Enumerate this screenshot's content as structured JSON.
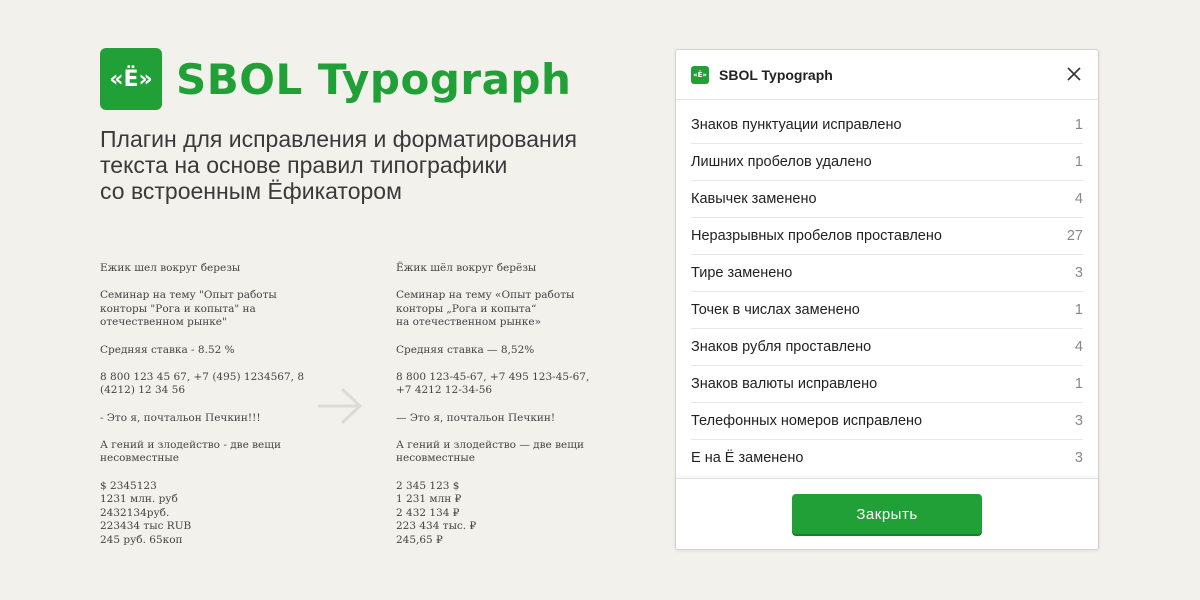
{
  "brand": {
    "logo_text": "«Ё»",
    "title": "SBOL Typograph"
  },
  "tagline": [
    "Плагин для исправления и форматирования",
    "текста на основе правил типографики",
    "со встроенным Ёфикатором"
  ],
  "sample_before": [
    "Ежик шел вокруг березы",
    "Семинар на тему \"Опыт работы\nконторы \"Рога и копыта\" на\nотечественном рынке\"",
    "Средняя ставка - 8.52 %",
    "8 800 123 45 67, +7 (495) 1234567, 8\n(4212) 12 34 56",
    "- Это я, почтальон Печкин!!!",
    "А гений и злодейство - две вещи\nнесовместные",
    "$ 2345123\n1231 млн. руб\n2432134руб.\n223434 тыс RUB\n245 руб. 65коп"
  ],
  "sample_after": [
    "Ёжик шёл вокруг берёзы",
    "Семинар на тему «Опыт работы\nконторы „Рога и копыта“\nна отечественном рынке»",
    "Средняя ставка — 8,52%",
    "8 800 123-45-67, +7 495 123-45-67,\n+7 4212 12-34-56",
    "— Это я, почтальон Печкин!",
    "А гений и злодейство — две вещи\nнесовместные",
    "2 345 123 $\n1 231 млн ₽\n2 432 134 ₽\n223 434 тыс. ₽\n245,65 ₽"
  ],
  "dialog": {
    "logo_text": "«Ё»",
    "title": "SBOL Typograph",
    "stats": [
      {
        "label": "Знаков пунктуации исправлено",
        "value": "1"
      },
      {
        "label": "Лишних пробелов удалено",
        "value": "1"
      },
      {
        "label": "Кавычек заменено",
        "value": "4"
      },
      {
        "label": "Неразрывных пробелов проставлено",
        "value": "27"
      },
      {
        "label": "Тире заменено",
        "value": "3"
      },
      {
        "label": "Точек в числах заменено",
        "value": "1"
      },
      {
        "label": "Знаков рубля проставлено",
        "value": "4"
      },
      {
        "label": "Знаков валюты исправлено",
        "value": "1"
      },
      {
        "label": "Телефонных номеров исправлено",
        "value": "3"
      },
      {
        "label": "Е на Ё заменено",
        "value": "3"
      }
    ],
    "close_label": "Закрыть"
  },
  "colors": {
    "brand_green": "#21a038",
    "background": "#f2f1ec"
  },
  "icons": {
    "arrow": "arrow-right-icon",
    "close": "close-icon"
  }
}
